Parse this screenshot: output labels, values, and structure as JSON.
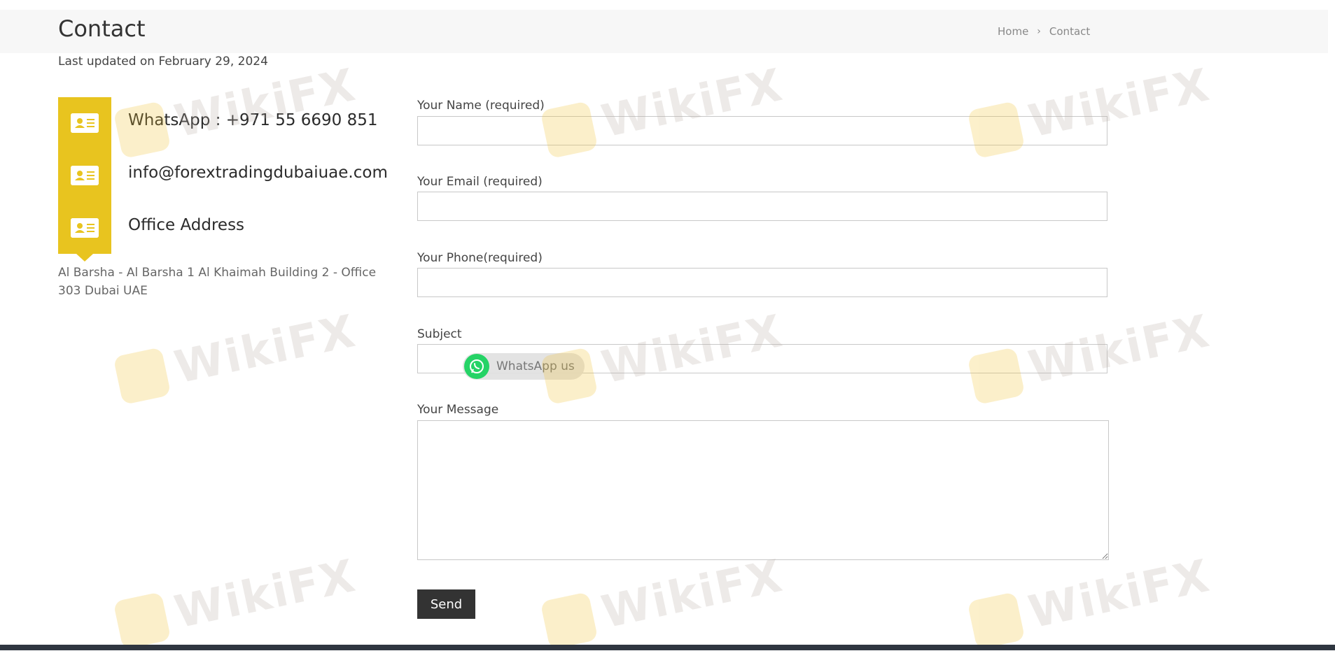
{
  "header": {
    "title": "Contact",
    "breadcrumb": {
      "home": "Home",
      "separator": "›",
      "current": "Contact"
    }
  },
  "updated": "Last updated on February 29, 2024",
  "contact_info": {
    "whatsapp": "WhatsApp : +971 55 6690 851",
    "email": "info@forextradingdubaiuae.com",
    "office_heading": "Office Address",
    "address": "Al Barsha - Al Barsha 1 Al Khaimah Building 2 - Office 303 Dubai UAE",
    "icon": "contact-card-icon",
    "accent_color": "#e8c41f"
  },
  "form": {
    "name_label": "Your Name (required)",
    "email_label": "Your Email (required)",
    "phone_label": "Your Phone(required)",
    "subject_label": "Subject",
    "message_label": "Your Message",
    "name_value": "",
    "email_value": "",
    "phone_value": "",
    "subject_value": "",
    "message_value": "",
    "send_label": "Send"
  },
  "whatsapp_widget": {
    "label": "WhatsApp us",
    "icon": "whatsapp-icon",
    "color": "#25d366"
  },
  "watermark": {
    "text": "WikiFX"
  }
}
